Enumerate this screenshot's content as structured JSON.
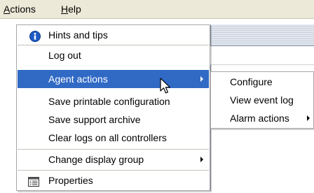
{
  "menubar": {
    "actions_prefix": "A",
    "actions_rest": "ctions",
    "help_prefix": "H",
    "help_rest": "elp"
  },
  "menu": {
    "items": [
      {
        "label": "Hints and tips",
        "icon": "info-icon"
      },
      {
        "label": "Log out"
      },
      {
        "label": "Agent actions",
        "submenu": true,
        "highlighted": true
      },
      {
        "label": "Save printable configuration"
      },
      {
        "label": "Save support archive"
      },
      {
        "label": "Clear logs on all controllers"
      },
      {
        "label": "Change display group",
        "submenu": true
      },
      {
        "label": "Properties",
        "icon": "properties-icon"
      }
    ]
  },
  "submenu": {
    "items": [
      {
        "label": "Configure"
      },
      {
        "label": "View event log"
      },
      {
        "label": "Alarm actions",
        "submenu": true
      }
    ]
  },
  "colors": {
    "highlight": "#316ac5",
    "menubar": "#ece9d8"
  },
  "icons": {
    "hints": "info-icon",
    "properties": "properties-icon",
    "cursor": "arrow-cursor-icon"
  }
}
